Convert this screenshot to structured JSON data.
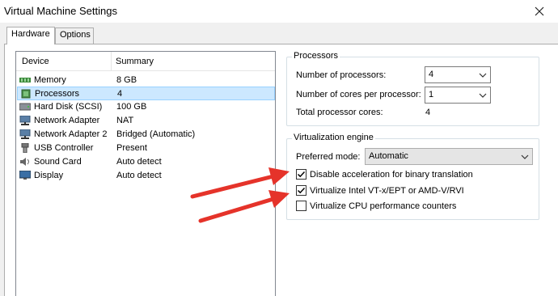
{
  "window": {
    "title": "Virtual Machine Settings"
  },
  "tabs": [
    {
      "label": "Hardware",
      "active": true
    },
    {
      "label": "Options",
      "active": false
    }
  ],
  "device_list": {
    "columns": [
      "Device",
      "Summary"
    ],
    "rows": [
      {
        "device": "Memory",
        "summary": "8 GB",
        "icon": "memory-icon",
        "selected": false
      },
      {
        "device": "Processors",
        "summary": "4",
        "icon": "processor-icon",
        "selected": true
      },
      {
        "device": "Hard Disk (SCSI)",
        "summary": "100 GB",
        "icon": "hard-disk-icon",
        "selected": false
      },
      {
        "device": "Network Adapter",
        "summary": "NAT",
        "icon": "network-adapter-icon",
        "selected": false
      },
      {
        "device": "Network Adapter 2",
        "summary": "Bridged (Automatic)",
        "icon": "network-adapter-icon",
        "selected": false
      },
      {
        "device": "USB Controller",
        "summary": "Present",
        "icon": "usb-icon",
        "selected": false
      },
      {
        "device": "Sound Card",
        "summary": "Auto detect",
        "icon": "sound-card-icon",
        "selected": false
      },
      {
        "device": "Display",
        "summary": "Auto detect",
        "icon": "display-icon",
        "selected": false
      }
    ]
  },
  "processors": {
    "group_label": "Processors",
    "num_processors_label": "Number of processors:",
    "num_processors_value": "4",
    "cores_label": "Number of cores per processor:",
    "cores_value": "1",
    "total_label": "Total processor cores:",
    "total_value": "4"
  },
  "virtualization": {
    "group_label": "Virtualization engine",
    "mode_label": "Preferred mode:",
    "mode_value": "Automatic",
    "options": [
      {
        "label": "Disable acceleration for binary translation",
        "checked": true
      },
      {
        "label": "Virtualize Intel VT-x/EPT or AMD-V/RVI",
        "checked": true
      },
      {
        "label": "Virtualize CPU performance counters",
        "checked": false
      }
    ]
  },
  "colors": {
    "annotation_arrow": "#e5332a",
    "selection": "#cce8ff"
  }
}
